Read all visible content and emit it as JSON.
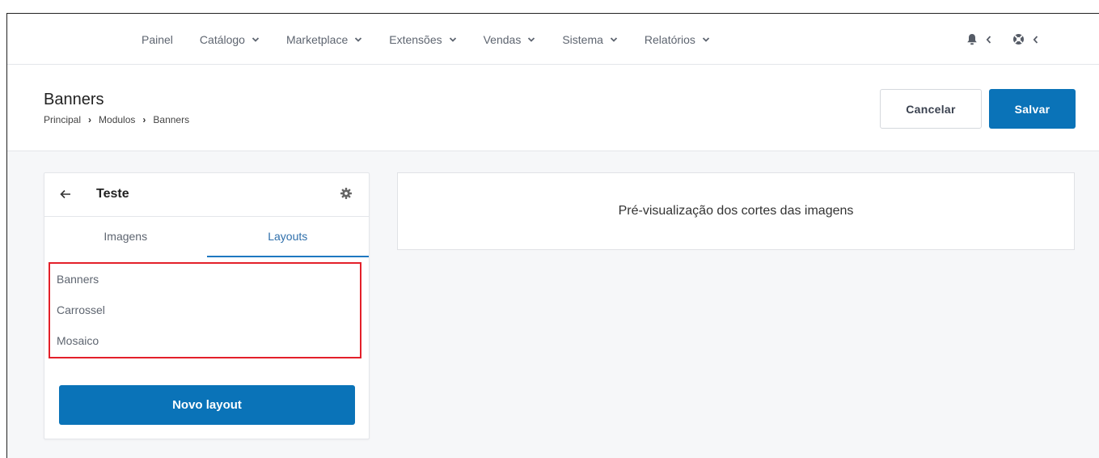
{
  "nav": {
    "items": [
      {
        "label": "Painel",
        "has_dropdown": false
      },
      {
        "label": "Catálogo",
        "has_dropdown": true
      },
      {
        "label": "Marketplace",
        "has_dropdown": true
      },
      {
        "label": "Extensões",
        "has_dropdown": true
      },
      {
        "label": "Vendas",
        "has_dropdown": true
      },
      {
        "label": "Sistema",
        "has_dropdown": true
      },
      {
        "label": "Relatórios",
        "has_dropdown": true
      }
    ],
    "right_icons": [
      "bell-icon",
      "lifebuoy-icon"
    ]
  },
  "header": {
    "title": "Banners",
    "breadcrumb": [
      "Principal",
      "Modulos",
      "Banners"
    ],
    "cancel_label": "Cancelar",
    "save_label": "Salvar"
  },
  "panel": {
    "title": "Teste",
    "tabs": [
      {
        "label": "Imagens",
        "active": false
      },
      {
        "label": "Layouts",
        "active": true
      }
    ],
    "layouts": [
      "Banners",
      "Carrossel",
      "Mosaico"
    ],
    "new_layout_label": "Novo layout"
  },
  "preview": {
    "text": "Pré-visualização dos cortes das imagens"
  },
  "colors": {
    "primary": "#0a73b8",
    "highlight_border": "#e3202a",
    "active_tab": "#1f78c1"
  }
}
